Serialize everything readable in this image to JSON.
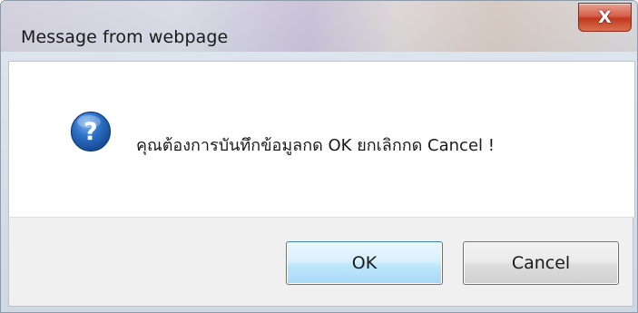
{
  "dialog": {
    "title": "Message from webpage",
    "close_label": "X",
    "message": "คุณต้องการบันทึกข้อมูลกด OK ยกเลิกกด Cancel !",
    "icon": "question-icon",
    "buttons": {
      "ok_label": "OK",
      "cancel_label": "Cancel"
    }
  },
  "colors": {
    "close_button": "#c1391f",
    "ok_border": "#3c7fb1",
    "icon_blue": "#1f5fae",
    "footer_bg": "#f0f0f0"
  }
}
